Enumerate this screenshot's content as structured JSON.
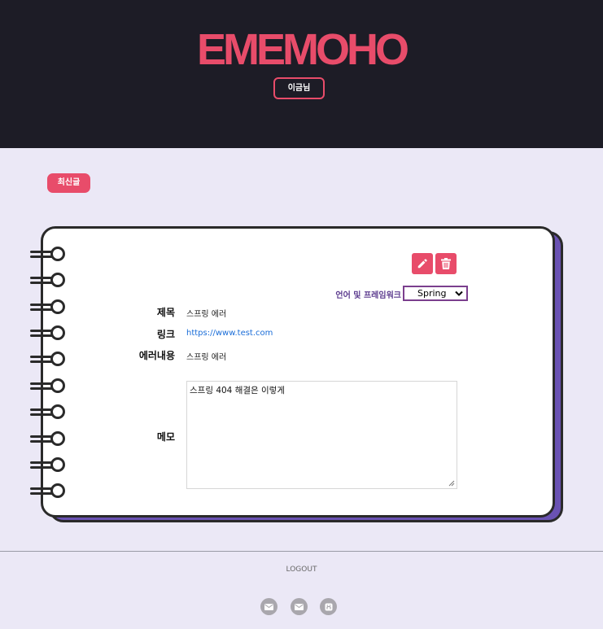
{
  "header": {
    "logo": "EMEMOHO",
    "user_button": "이금님"
  },
  "main": {
    "latest_button": "최신글"
  },
  "memo_card": {
    "framework_label": "언어 및 프레임워크",
    "framework_selected": "Spring",
    "title_label": "제목",
    "title_value": "스프링 에러",
    "link_label": "링크",
    "link_value": "https://www.test.com",
    "error_label": "에러내용",
    "error_value": "스프링 에러",
    "memo_label": "메모",
    "memo_value": "스프링 404 해결은 이렇게"
  },
  "footer": {
    "logout": "LOGOUT"
  },
  "colors": {
    "accent": "#e84c6a",
    "header_bg": "#1d1c26",
    "page_bg": "#ebe8f6",
    "notebook_back": "#6a52b3"
  },
  "icons": [
    "pencil-icon",
    "trash-icon",
    "mail-icon",
    "mail-icon",
    "github-icon"
  ]
}
